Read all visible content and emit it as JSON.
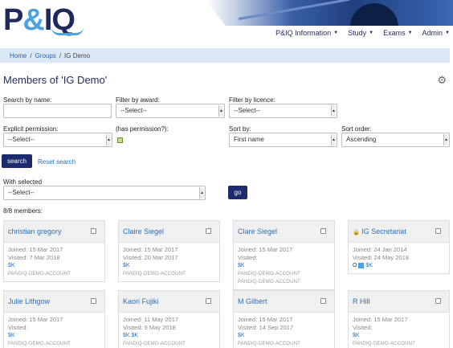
{
  "header": {
    "logo": {
      "p": "P",
      "amp": "&",
      "iq": "IQ"
    },
    "nav": [
      {
        "label": "P&IQ Information"
      },
      {
        "label": "Study"
      },
      {
        "label": "Exams"
      },
      {
        "label": "Admin"
      }
    ]
  },
  "breadcrumb": [
    "Home",
    "/",
    "Groups",
    "/",
    "IG Demo"
  ],
  "title": "Members of 'IG Demo'",
  "form": {
    "search_name_label": "Search by name:",
    "search_name_value": "",
    "award_label": "Filter by award:",
    "award_value": "--Select--",
    "licence_label": "Filter by licence:",
    "licence_value": "--Select--",
    "explicit_label": "Explicit permission:",
    "explicit_value": "--Select--",
    "has_perm_label": "(has permission?):",
    "sort_by_label": "Sort by:",
    "sort_by_value": "First name",
    "sort_order_label": "Sort order:",
    "sort_order_value": "Ascending",
    "search_button": "search",
    "reset_link": "Reset search",
    "with_selected_label": "With selected",
    "with_selected_value": "--Select--",
    "go_button": "go"
  },
  "members_count": "8/8 members:",
  "members": [
    {
      "name": "christian gregory",
      "joined": "Joined: 15 Mar 2017",
      "visited": "Visited: 7 Mar 2018",
      "badges": "$K",
      "acct": "PANDIQ-DEMO-ACCOUNT",
      "locked": false
    },
    {
      "name": "Claire Siegel",
      "joined": "Joined: 15 Mar 2017",
      "visited": "Visited: 20 Mar 2017",
      "badges": "$K",
      "acct": "PANDIQ-DEMO-ACCOUNT",
      "locked": false
    },
    {
      "name": "Clare Siegel",
      "joined": "Joined: 15 Mar 2017",
      "visited": "Visited:",
      "badges": "$K",
      "acct": "PANDIQ-DEMO-ACCOUNT",
      "acct2": "PANDIQ-DEMO-ACCOUNT",
      "locked": false
    },
    {
      "name": "IG Secretariat",
      "joined": "Joined: 24 Jan 2014",
      "visited": "Visited: 24 May 2018",
      "badges": "O",
      "badges2": "$K",
      "acct": "",
      "locked": true
    },
    {
      "name": "Julie Lithgow",
      "joined": "Joined: 15 Mar 2017",
      "visited": "Visited:",
      "badges": "$K",
      "acct": "PANDIQ-DEMO-ACCOUNT",
      "locked": false
    },
    {
      "name": "Kaori Fujiki",
      "joined": "Joined: 11 May 2017",
      "visited": "Visited: 9 May 2018",
      "badges": "$K $K",
      "acct": "PANDIQ-DEMO-ACCOUNT",
      "locked": false
    },
    {
      "name": "M Gilbert",
      "joined": "Joined: 15 Mar 2017",
      "visited": "Visited: 14 Sep 2017",
      "badges": "$K",
      "acct": "PANDIQ-DEMO-ACCOUNT",
      "locked": false
    },
    {
      "name": "R Hill",
      "joined": "Joined: 15 Mar 2017",
      "visited": "Visited:",
      "badges": "$K",
      "acct": "PANDIQ-DEMO-ACCOUNT",
      "locked": false
    }
  ]
}
